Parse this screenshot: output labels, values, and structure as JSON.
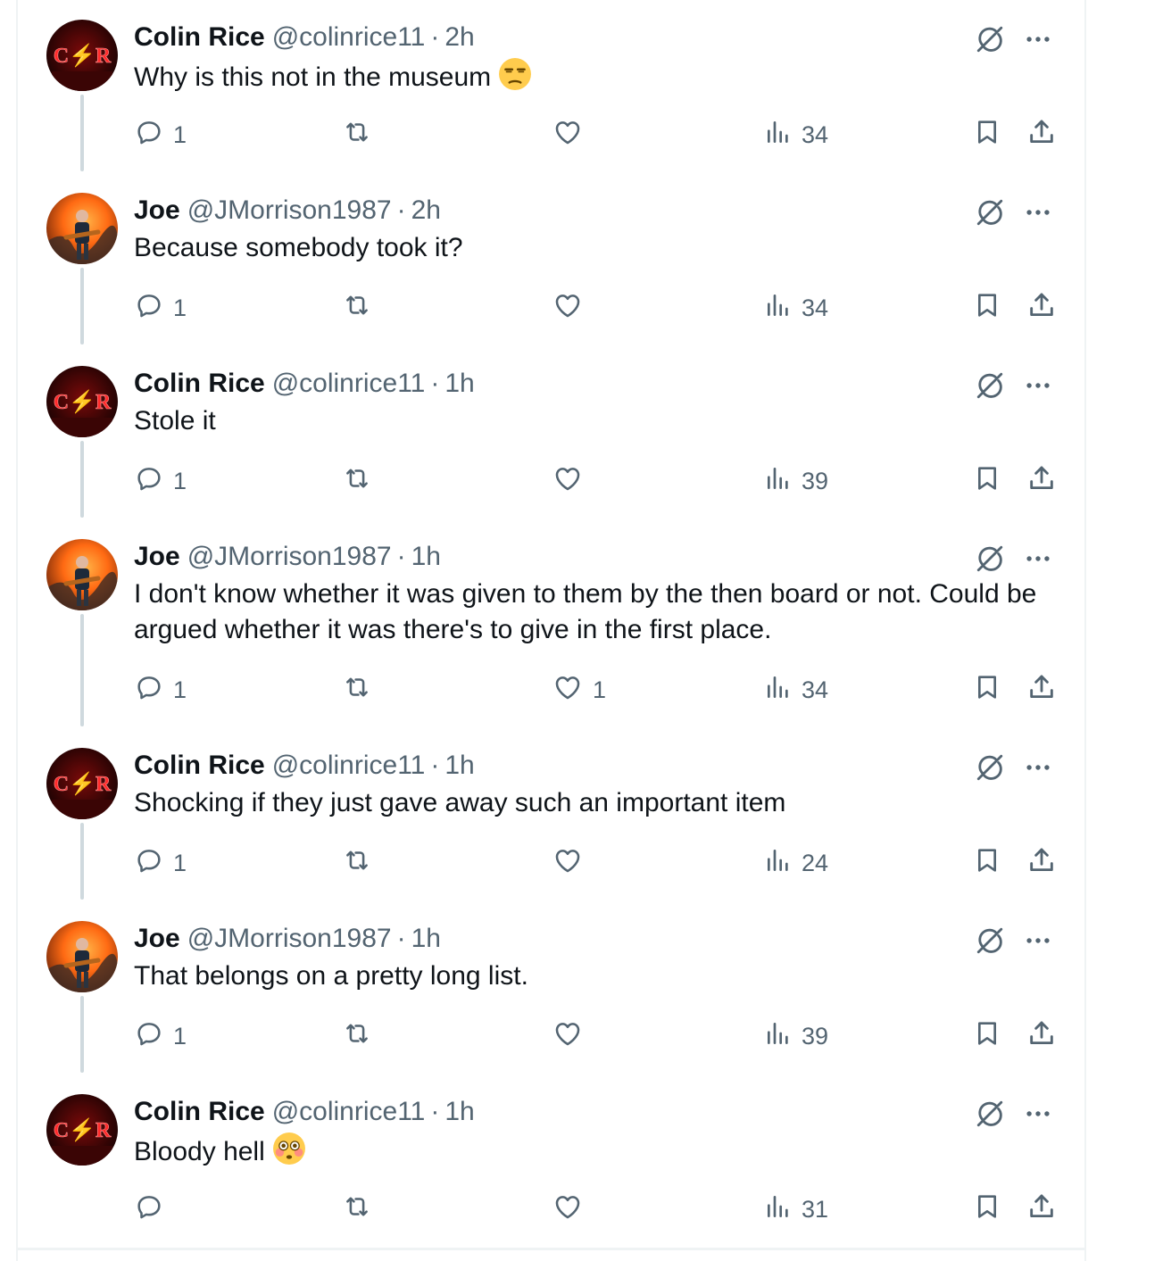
{
  "colors": {
    "icon": "#536471",
    "thread_line": "#cfd9de",
    "text": "#0f1419"
  },
  "tweets": [
    {
      "user": "colin",
      "name": "Colin Rice",
      "handle": "@colinrice11",
      "time": "2h",
      "text": "Why is this not in the museum",
      "emoji": "unamused-face",
      "replies": "1",
      "retweets": "",
      "likes": "",
      "views": "34"
    },
    {
      "user": "joe",
      "name": "Joe",
      "handle": "@JMorrison1987",
      "time": "2h",
      "text": "Because somebody took it?",
      "emoji": "",
      "replies": "1",
      "retweets": "",
      "likes": "",
      "views": "34"
    },
    {
      "user": "colin",
      "name": "Colin Rice",
      "handle": "@colinrice11",
      "time": "1h",
      "text": "Stole it",
      "emoji": "",
      "replies": "1",
      "retweets": "",
      "likes": "",
      "views": "39"
    },
    {
      "user": "joe",
      "name": "Joe",
      "handle": "@JMorrison1987",
      "time": "1h",
      "text": "I don't know whether it was given to them by the then board or not. Could be argued whether it was there's to give in the first place.",
      "emoji": "",
      "replies": "1",
      "retweets": "",
      "likes": "1",
      "views": "34"
    },
    {
      "user": "colin",
      "name": "Colin Rice",
      "handle": "@colinrice11",
      "time": "1h",
      "text": "Shocking if they just gave away such an important item",
      "emoji": "",
      "replies": "1",
      "retweets": "",
      "likes": "",
      "views": "24"
    },
    {
      "user": "joe",
      "name": "Joe",
      "handle": "@JMorrison1987",
      "time": "1h",
      "text": "That belongs on a pretty long list.",
      "emoji": "",
      "replies": "1",
      "retweets": "",
      "likes": "",
      "views": "39"
    },
    {
      "user": "colin",
      "name": "Colin Rice",
      "handle": "@colinrice11",
      "time": "1h",
      "text": "Bloody hell",
      "emoji": "flushed-face",
      "replies": "",
      "retweets": "",
      "likes": "",
      "views": "31"
    }
  ],
  "avatar_text": {
    "colin": "C⚡R"
  }
}
